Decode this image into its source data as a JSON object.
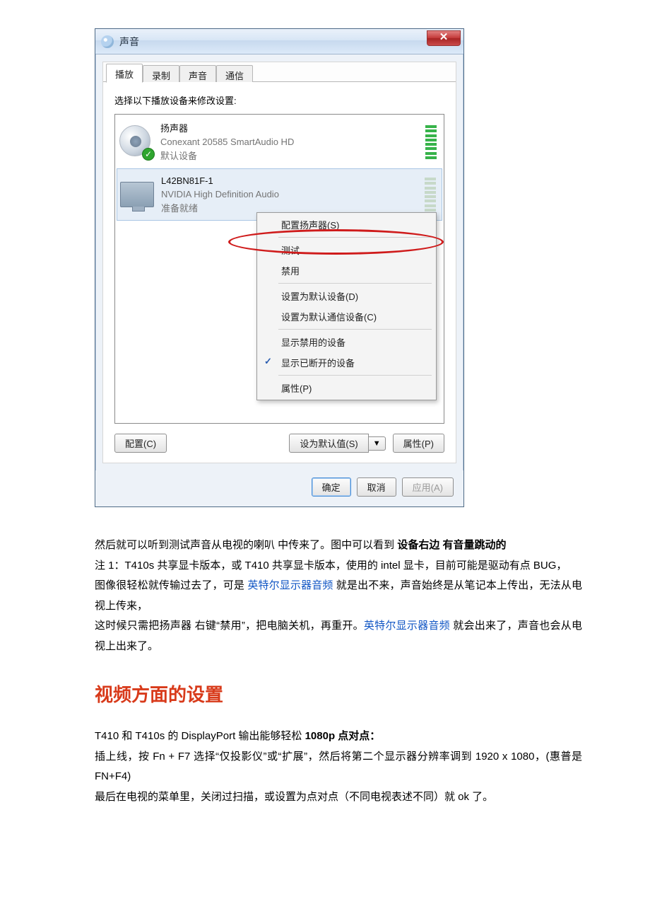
{
  "dialog": {
    "title": "声音",
    "tabs": {
      "playback": "播放",
      "recording": "录制",
      "sounds": "声音",
      "communications": "通信"
    },
    "instruction": "选择以下播放设备来修改设置:",
    "device1": {
      "name": "扬声器",
      "desc": "Conexant 20585 SmartAudio HD",
      "status": "默认设备"
    },
    "device2": {
      "name": "L42BN81F-1",
      "desc": "NVIDIA High Definition Audio",
      "status": "准备就绪"
    },
    "menu": {
      "configure": "配置扬声器(S)",
      "test": "测试",
      "disable": "禁用",
      "setDefault": "设置为默认设备(D)",
      "setDefaultComm": "设置为默认通信设备(C)",
      "showDisabled": "显示禁用的设备",
      "showDisconnected": "显示已断开的设备",
      "properties": "属性(P)"
    },
    "buttons": {
      "configure": "配置(C)",
      "setDefault": "设为默认值(S)",
      "properties": "属性(P)",
      "ok": "确定",
      "cancel": "取消",
      "apply": "应用(A)"
    }
  },
  "article": {
    "p1a": "然后就可以听到测试声音从电视的喇叭 中传来了。图中可以看到 ",
    "p1b": "设备右边 有音量跳动的",
    "p2": "注 1：T410s 共享显卡版本，或 T410 共享显卡版本，使用的 intel 显卡，目前可能是驱动有点 BUG，",
    "p3a": "图像很轻松就传输过去了，可是 ",
    "p3link1": "英特尔显示器音频",
    "p3b": " 就是出不来，声音始终是从笔记本上传出，无法从电视上传来，",
    "p4a": "这时候只需把扬声器 右键“禁用”，把电脑关机，再重开。",
    "p4link": "英特尔显示器音频",
    "p4b": " 就会出来了，声音也会从电视上出来了。",
    "h2": "视频方面的设置",
    "p5a": "T410 和 T410s 的 DisplayPort 输出能够轻松 ",
    "p5b": "1080p 点对点：",
    "p6": "插上线，按 Fn + F7 选择“仅投影仪”或“扩展”，然后将第二个显示器分辨率调到 1920 x 1080，(惠普是 FN+F4)",
    "p7": "最后在电视的菜单里，关闭过扫描，或设置为点对点（不同电视表述不同）就 ok 了。"
  }
}
